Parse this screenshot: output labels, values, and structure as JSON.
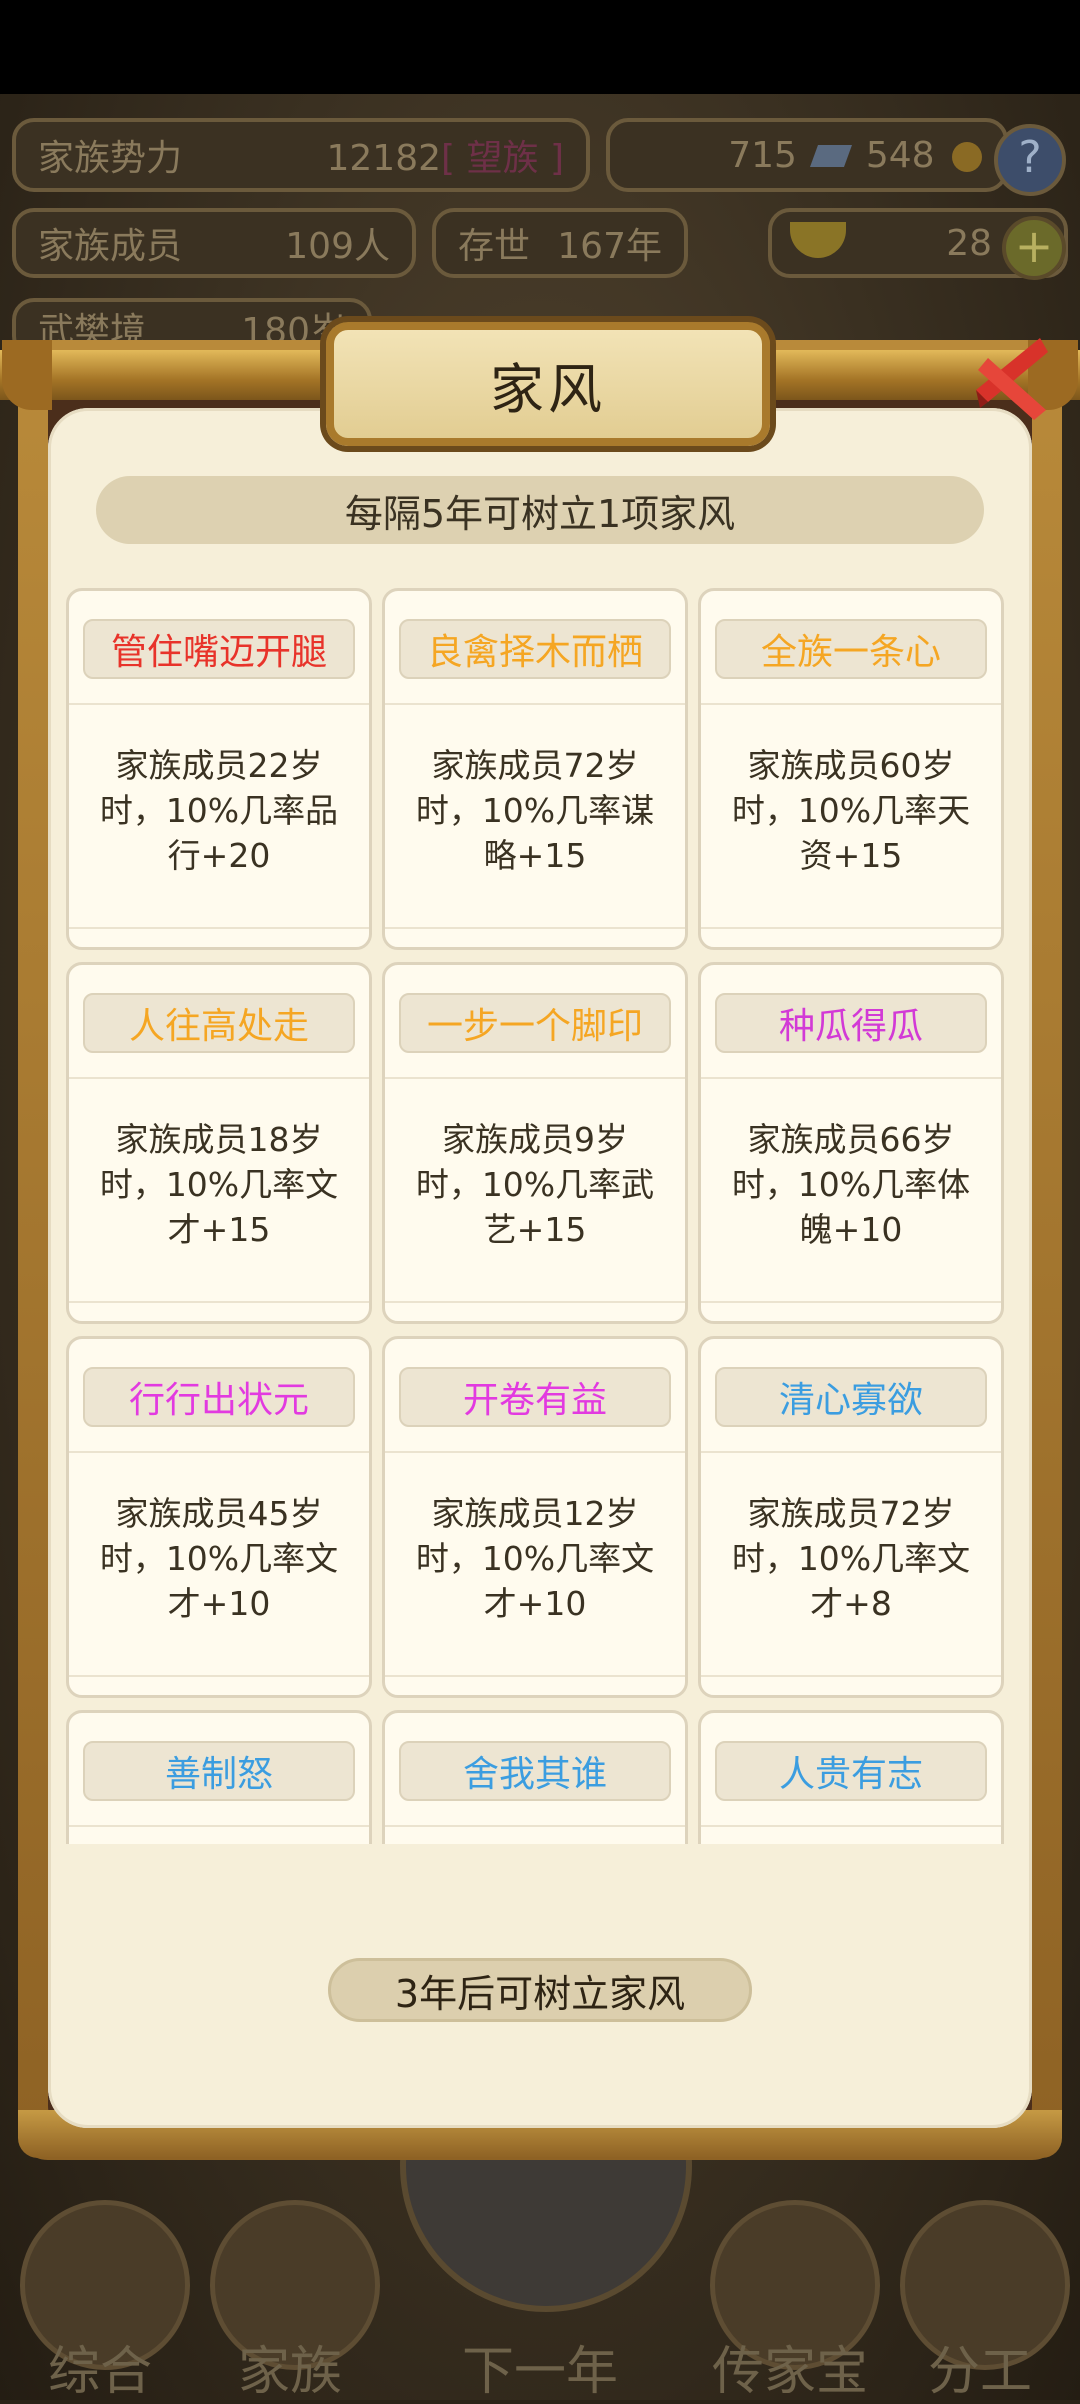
{
  "top_bar": {
    "power_label": "家族势力",
    "power_value": "12182",
    "power_rank": "[ 望族 ]",
    "currency1": "715",
    "currency2": "548",
    "members_label": "家族成员",
    "members_value": "109人",
    "exist_label": "存世",
    "exist_value": "167年",
    "gold_value": "28",
    "realm_label": "武樊境",
    "realm_value": "180岁"
  },
  "dialog": {
    "title": "家风",
    "info": "每隔5年可树立1项家风",
    "footer_button": "3年后可树立家风",
    "cards": [
      {
        "name": "管住嘴迈开腿",
        "color": "#e8332a",
        "lines": [
          "家族成员22岁",
          "时，10%几率品",
          "行+20"
        ]
      },
      {
        "name": "良禽择木而栖",
        "color": "#f5a623",
        "lines": [
          "家族成员72岁",
          "时，10%几率谋",
          "略+15"
        ]
      },
      {
        "name": "全族一条心",
        "color": "#f5a623",
        "lines": [
          "家族成员60岁",
          "时，10%几率天",
          "资+15"
        ]
      },
      {
        "name": "人往高处走",
        "color": "#f5a623",
        "lines": [
          "家族成员18岁",
          "时，10%几率文",
          "才+15"
        ]
      },
      {
        "name": "一步一个脚印",
        "color": "#f5a623",
        "lines": [
          "家族成员9岁",
          "时，10%几率武",
          "艺+15"
        ]
      },
      {
        "name": "种瓜得瓜",
        "color": "#d23ad6",
        "lines": [
          "家族成员66岁",
          "时，10%几率体",
          "魄+10"
        ]
      },
      {
        "name": "行行出状元",
        "color": "#e23ae0",
        "lines": [
          "家族成员45岁",
          "时，10%几率文",
          "才+10"
        ]
      },
      {
        "name": "开卷有益",
        "color": "#e23ae0",
        "lines": [
          "家族成员12岁",
          "时，10%几率文",
          "才+10"
        ]
      },
      {
        "name": "清心寡欲",
        "color": "#3b9de0",
        "lines": [
          "家族成员72岁",
          "时，10%几率文",
          "才+8"
        ]
      },
      {
        "name": "善制怒",
        "color": "#3b9de0",
        "lines": [
          "",
          "",
          ""
        ]
      },
      {
        "name": "舍我其谁",
        "color": "#3b9de0",
        "lines": [
          "",
          "",
          ""
        ]
      },
      {
        "name": "人贵有志",
        "color": "#3b9de0",
        "lines": [
          "",
          "",
          ""
        ]
      }
    ]
  },
  "bottom_nav": [
    {
      "label": "综合"
    },
    {
      "label": "家族"
    },
    {
      "label": "下一年"
    },
    {
      "label": "传家宝"
    },
    {
      "label": "分工"
    }
  ]
}
